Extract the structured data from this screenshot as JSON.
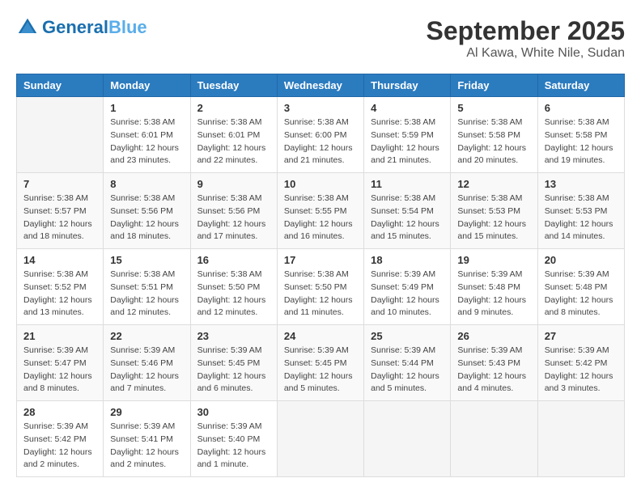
{
  "header": {
    "logo_general": "General",
    "logo_blue": "Blue",
    "month": "September 2025",
    "location": "Al Kawa, White Nile, Sudan"
  },
  "days_of_week": [
    "Sunday",
    "Monday",
    "Tuesday",
    "Wednesday",
    "Thursday",
    "Friday",
    "Saturday"
  ],
  "weeks": [
    [
      {
        "day": "",
        "info": ""
      },
      {
        "day": "1",
        "info": "Sunrise: 5:38 AM\nSunset: 6:01 PM\nDaylight: 12 hours\nand 23 minutes."
      },
      {
        "day": "2",
        "info": "Sunrise: 5:38 AM\nSunset: 6:01 PM\nDaylight: 12 hours\nand 22 minutes."
      },
      {
        "day": "3",
        "info": "Sunrise: 5:38 AM\nSunset: 6:00 PM\nDaylight: 12 hours\nand 21 minutes."
      },
      {
        "day": "4",
        "info": "Sunrise: 5:38 AM\nSunset: 5:59 PM\nDaylight: 12 hours\nand 21 minutes."
      },
      {
        "day": "5",
        "info": "Sunrise: 5:38 AM\nSunset: 5:58 PM\nDaylight: 12 hours\nand 20 minutes."
      },
      {
        "day": "6",
        "info": "Sunrise: 5:38 AM\nSunset: 5:58 PM\nDaylight: 12 hours\nand 19 minutes."
      }
    ],
    [
      {
        "day": "7",
        "info": "Sunrise: 5:38 AM\nSunset: 5:57 PM\nDaylight: 12 hours\nand 18 minutes."
      },
      {
        "day": "8",
        "info": "Sunrise: 5:38 AM\nSunset: 5:56 PM\nDaylight: 12 hours\nand 18 minutes."
      },
      {
        "day": "9",
        "info": "Sunrise: 5:38 AM\nSunset: 5:56 PM\nDaylight: 12 hours\nand 17 minutes."
      },
      {
        "day": "10",
        "info": "Sunrise: 5:38 AM\nSunset: 5:55 PM\nDaylight: 12 hours\nand 16 minutes."
      },
      {
        "day": "11",
        "info": "Sunrise: 5:38 AM\nSunset: 5:54 PM\nDaylight: 12 hours\nand 15 minutes."
      },
      {
        "day": "12",
        "info": "Sunrise: 5:38 AM\nSunset: 5:53 PM\nDaylight: 12 hours\nand 15 minutes."
      },
      {
        "day": "13",
        "info": "Sunrise: 5:38 AM\nSunset: 5:53 PM\nDaylight: 12 hours\nand 14 minutes."
      }
    ],
    [
      {
        "day": "14",
        "info": "Sunrise: 5:38 AM\nSunset: 5:52 PM\nDaylight: 12 hours\nand 13 minutes."
      },
      {
        "day": "15",
        "info": "Sunrise: 5:38 AM\nSunset: 5:51 PM\nDaylight: 12 hours\nand 12 minutes."
      },
      {
        "day": "16",
        "info": "Sunrise: 5:38 AM\nSunset: 5:50 PM\nDaylight: 12 hours\nand 12 minutes."
      },
      {
        "day": "17",
        "info": "Sunrise: 5:38 AM\nSunset: 5:50 PM\nDaylight: 12 hours\nand 11 minutes."
      },
      {
        "day": "18",
        "info": "Sunrise: 5:39 AM\nSunset: 5:49 PM\nDaylight: 12 hours\nand 10 minutes."
      },
      {
        "day": "19",
        "info": "Sunrise: 5:39 AM\nSunset: 5:48 PM\nDaylight: 12 hours\nand 9 minutes."
      },
      {
        "day": "20",
        "info": "Sunrise: 5:39 AM\nSunset: 5:48 PM\nDaylight: 12 hours\nand 8 minutes."
      }
    ],
    [
      {
        "day": "21",
        "info": "Sunrise: 5:39 AM\nSunset: 5:47 PM\nDaylight: 12 hours\nand 8 minutes."
      },
      {
        "day": "22",
        "info": "Sunrise: 5:39 AM\nSunset: 5:46 PM\nDaylight: 12 hours\nand 7 minutes."
      },
      {
        "day": "23",
        "info": "Sunrise: 5:39 AM\nSunset: 5:45 PM\nDaylight: 12 hours\nand 6 minutes."
      },
      {
        "day": "24",
        "info": "Sunrise: 5:39 AM\nSunset: 5:45 PM\nDaylight: 12 hours\nand 5 minutes."
      },
      {
        "day": "25",
        "info": "Sunrise: 5:39 AM\nSunset: 5:44 PM\nDaylight: 12 hours\nand 5 minutes."
      },
      {
        "day": "26",
        "info": "Sunrise: 5:39 AM\nSunset: 5:43 PM\nDaylight: 12 hours\nand 4 minutes."
      },
      {
        "day": "27",
        "info": "Sunrise: 5:39 AM\nSunset: 5:42 PM\nDaylight: 12 hours\nand 3 minutes."
      }
    ],
    [
      {
        "day": "28",
        "info": "Sunrise: 5:39 AM\nSunset: 5:42 PM\nDaylight: 12 hours\nand 2 minutes."
      },
      {
        "day": "29",
        "info": "Sunrise: 5:39 AM\nSunset: 5:41 PM\nDaylight: 12 hours\nand 2 minutes."
      },
      {
        "day": "30",
        "info": "Sunrise: 5:39 AM\nSunset: 5:40 PM\nDaylight: 12 hours\nand 1 minute."
      },
      {
        "day": "",
        "info": ""
      },
      {
        "day": "",
        "info": ""
      },
      {
        "day": "",
        "info": ""
      },
      {
        "day": "",
        "info": ""
      }
    ]
  ]
}
